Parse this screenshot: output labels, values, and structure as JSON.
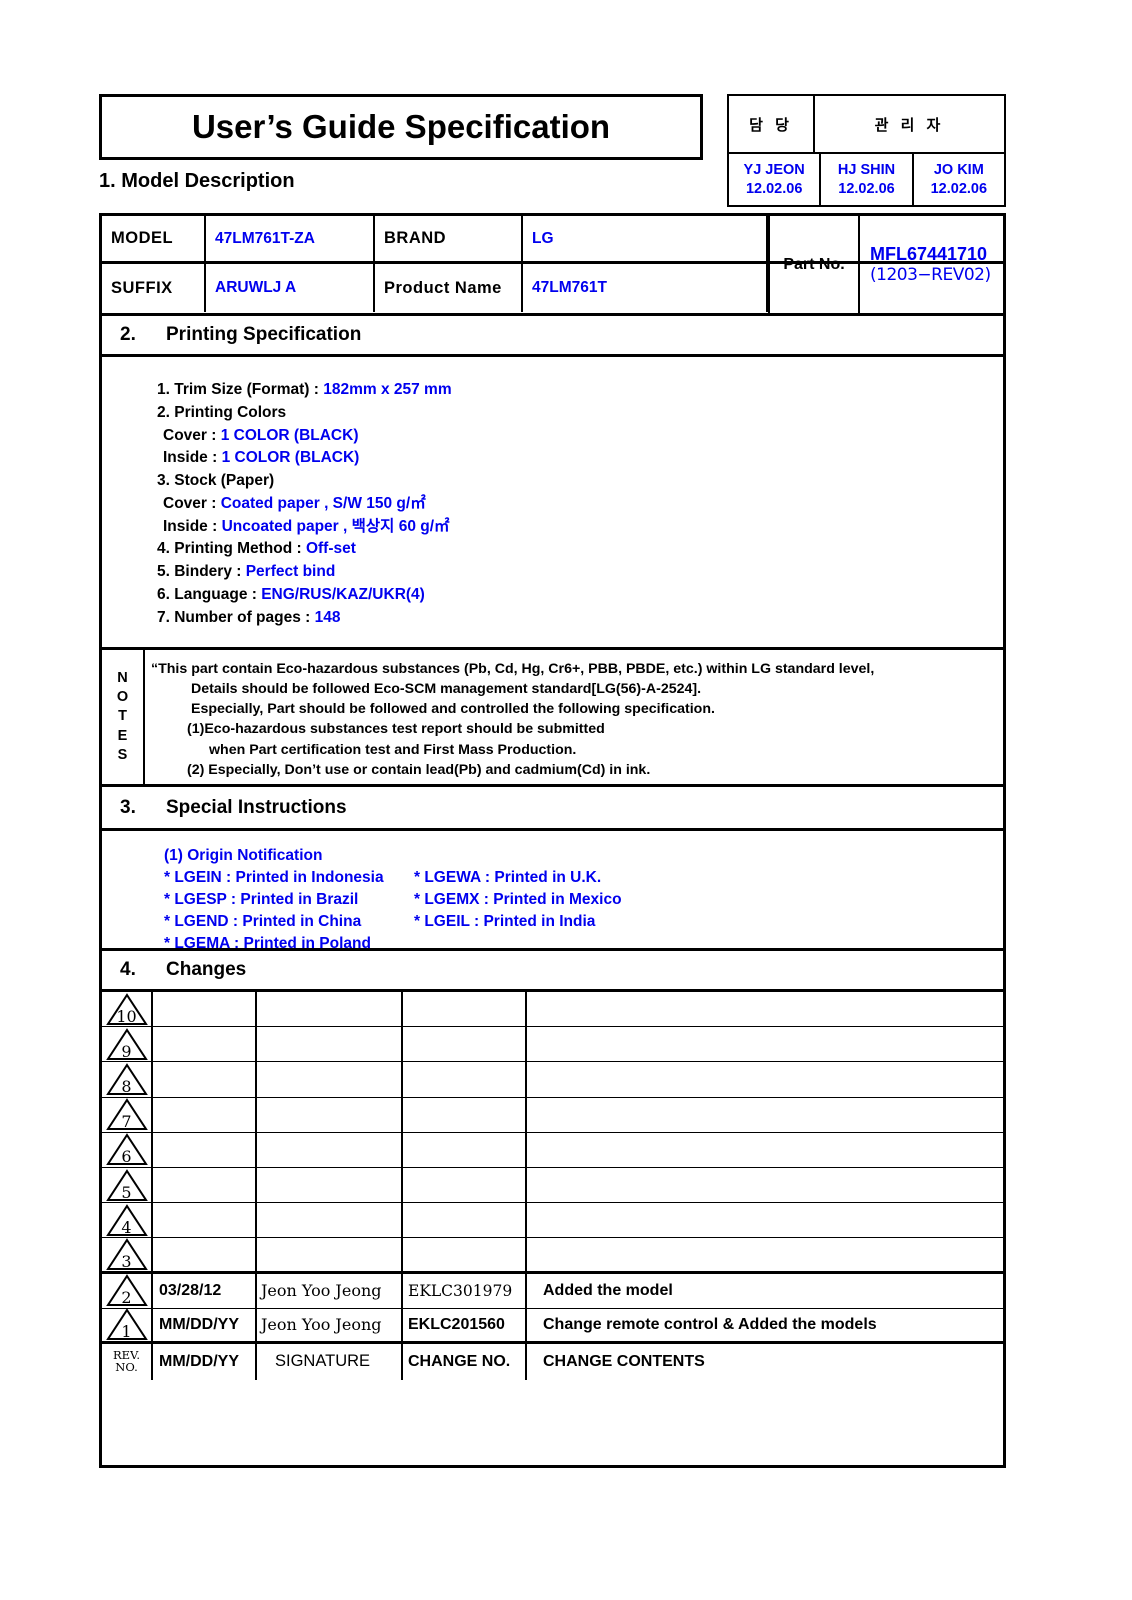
{
  "document": {
    "title": "User’s Guide Specification"
  },
  "approval": {
    "columns": [
      {
        "header": "담 당"
      },
      {
        "header": "관 리 자"
      }
    ],
    "signers": [
      {
        "name": "YJ JEON",
        "date": "12.02.06"
      },
      {
        "name": "HJ SHIN",
        "date": "12.02.06"
      },
      {
        "name": "JO KIM",
        "date": "12.02.06"
      }
    ],
    "accent_color": "#0000ee"
  },
  "section1": {
    "heading": "1. Model Description",
    "fields": {
      "model_label": "MODEL",
      "model_value": "47LM761T-ZA",
      "brand_label": "BRAND",
      "brand_value": "LG",
      "suffix_label": "SUFFIX",
      "suffix_value": "ARUWLJ A",
      "product_name_label": "Product Name",
      "product_name_value": "47LM761T",
      "part_no_label": "Part No.",
      "part_no_value": "MFL67441710",
      "part_no_revision": "(1203−REV02)"
    }
  },
  "section2": {
    "number": "2.",
    "heading": "Printing Specification",
    "items": [
      {
        "key": "1. Trim Size (Format) : ",
        "value": "182mm x 257 mm",
        "indent": false
      },
      {
        "key": "2. Printing Colors",
        "value": "",
        "indent": false
      },
      {
        "key": "Cover : ",
        "value": "1 COLOR (BLACK)",
        "indent": true
      },
      {
        "key": "Inside : ",
        "value": "1 COLOR (BLACK)",
        "indent": true
      },
      {
        "key": "3. Stock (Paper)",
        "value": "",
        "indent": false
      },
      {
        "key": "Cover : ",
        "value": "Coated paper , S/W 150 g/㎡",
        "indent": true
      },
      {
        "key": "Inside : ",
        "value": "Uncoated paper , 백상지 60 g/㎡",
        "indent": true
      },
      {
        "key": "4. Printing Method : ",
        "value": "Off-set",
        "indent": false
      },
      {
        "key": "5. Bindery  : ",
        "value": "Perfect bind",
        "indent": false
      },
      {
        "key": "6. Language : ",
        "value": "ENG/RUS/KAZ/UKR(4)",
        "indent": false
      },
      {
        "key": "7. Number of pages : ",
        "value": "148",
        "indent": false
      }
    ]
  },
  "notes": {
    "label_letters": [
      "N",
      "O",
      "T",
      "E",
      "S"
    ],
    "lines": [
      {
        "text": "“This part contain Eco-hazardous substances (Pb, Cd, Hg, Cr6+, PBB, PBDE, etc.) within LG standard level,",
        "indent": 0
      },
      {
        "text": "Details should be followed Eco-SCM management standard[LG(56)-A-2524].",
        "indent": 1
      },
      {
        "text": "Especially, Part should be followed and controlled the following specification.",
        "indent": 1
      },
      {
        "text": "(1)Eco-hazardous substances test report should be submitted",
        "indent": 2
      },
      {
        "text": "when  Part certification test and First Mass Production.",
        "indent": 3
      },
      {
        "text": "(2) Especially, Don’t use or contain lead(Pb) and cadmium(Cd) in ink.",
        "indent": 2
      }
    ]
  },
  "section3": {
    "number": "3.",
    "heading": "Special Instructions",
    "subheading": "(1) Origin Notification",
    "origins": [
      {
        "left": "* LGEIN : Printed in Indonesia",
        "right": "* LGEWA : Printed in U.K."
      },
      {
        "left": "* LGESP : Printed in Brazil",
        "right": "* LGEMX : Printed in Mexico"
      },
      {
        "left": "* LGEND : Printed in China",
        "right": " * LGEIL : Printed in India"
      },
      {
        "left": "* LGEMA : Printed in Poland",
        "right": ""
      }
    ]
  },
  "section4": {
    "number": "4.",
    "heading": "Changes",
    "rows": [
      {
        "rev": "10",
        "date": "",
        "signature": "",
        "change_no": "",
        "contents": ""
      },
      {
        "rev": "9",
        "date": "",
        "signature": "",
        "change_no": "",
        "contents": ""
      },
      {
        "rev": "8",
        "date": "",
        "signature": "",
        "change_no": "",
        "contents": ""
      },
      {
        "rev": "7",
        "date": "",
        "signature": "",
        "change_no": "",
        "contents": ""
      },
      {
        "rev": "6",
        "date": "",
        "signature": "",
        "change_no": "",
        "contents": ""
      },
      {
        "rev": "5",
        "date": "",
        "signature": "",
        "change_no": "",
        "contents": ""
      },
      {
        "rev": "4",
        "date": "",
        "signature": "",
        "change_no": "",
        "contents": ""
      },
      {
        "rev": "3",
        "date": "",
        "signature": "",
        "change_no": "",
        "contents": ""
      },
      {
        "rev": "2",
        "date": "03/28/12",
        "signature": "Jeon Yoo Jeong",
        "change_no": "EKLC301979",
        "contents": "Added the model"
      },
      {
        "rev": "1",
        "date": "MM/DD/YY",
        "signature": "Jeon Yoo Jeong",
        "change_no": "EKLC201560",
        "contents": "Change remote control & Added the models"
      }
    ],
    "header": {
      "rev_no_line1": "REV.",
      "rev_no_line2": "NO.",
      "date": "MM/DD/YY",
      "signature": "SIGNATURE",
      "change_no": "CHANGE NO.",
      "contents": "CHANGE   CONTENTS"
    }
  }
}
